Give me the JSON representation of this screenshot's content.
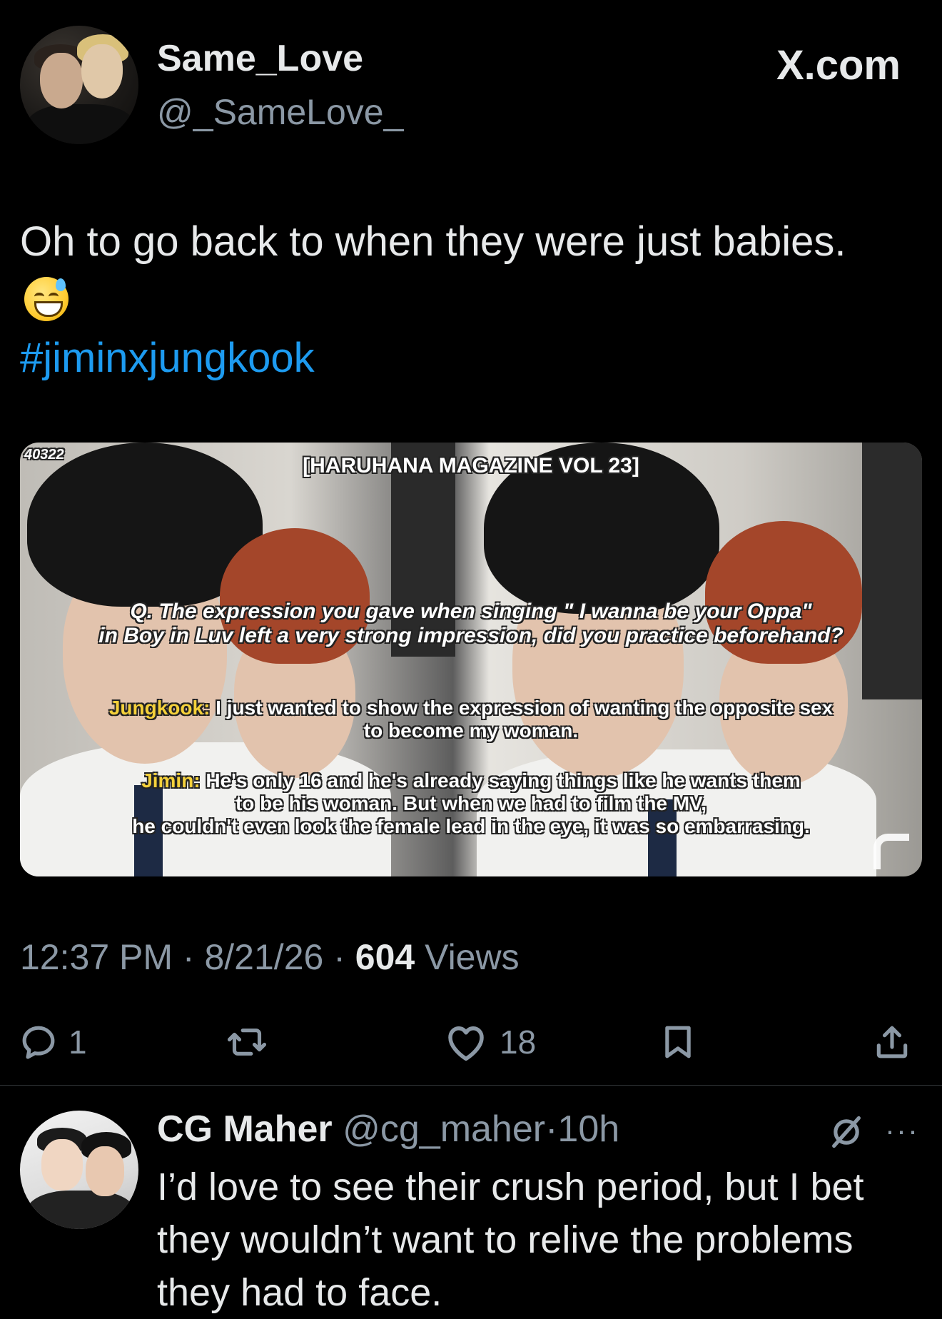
{
  "tweet": {
    "display_name": "Same_Love",
    "handle": "@_SameLove_",
    "brand": "X.com",
    "text": "Oh to go back to when they were just babies.",
    "emoji": "sweat-smile-emoji",
    "hashtag": "#jiminxjungkook",
    "time": "12:37 PM",
    "date": "8/21/26",
    "views_count": "604",
    "views_label": "Views",
    "separator": "·"
  },
  "media": {
    "stamp": "40322",
    "title": "[HARUHANA MAGAZINE VOL 23]",
    "question_line1": "Q. The expression you gave when singing \" I wanna be your Oppa\"",
    "question_line2": "in Boy in Luv left a very strong impression, did you practice beforehand?",
    "jungkook_label": "Jungkook:",
    "jungkook_line1": " I just wanted to show the expression of wanting the opposite sex",
    "jungkook_line2": "to become my woman.",
    "jimin_label": "Jimin:",
    "jimin_line1": " He's only 16 and he's already saying things like he wants them",
    "jimin_line2": "to be his woman. But when we had to film the MV,",
    "jimin_line3": "he couldn't even look the female lead in the eye, it was so embarrasing."
  },
  "actions": {
    "reply_count": "1",
    "retweet_count": "",
    "like_count": "18",
    "icons": [
      "reply-icon",
      "retweet-icon",
      "like-icon",
      "bookmark-icon",
      "share-icon"
    ]
  },
  "reply": {
    "name": "CG Maher",
    "handle": "@cg_maher",
    "separator": "·",
    "time": "10h",
    "more": "···",
    "text": "I’d love to see their crush period, but I bet they wouldn’t want to relive the problems they had to face."
  },
  "colors": {
    "background": "#000000",
    "text": "#e7e9ea",
    "muted": "#8b98a5",
    "link": "#1d9bf0",
    "caption_highlight": "#f5d13b"
  }
}
